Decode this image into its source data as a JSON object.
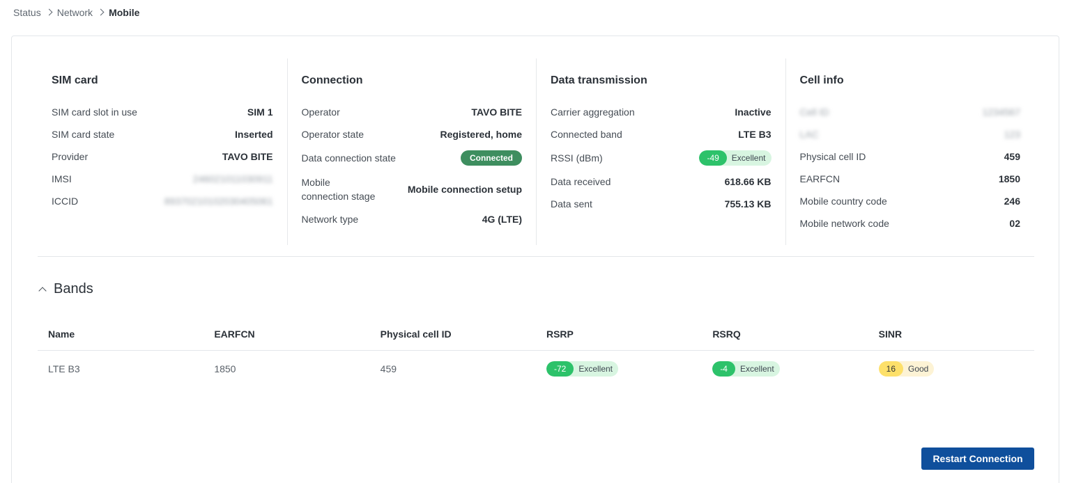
{
  "breadcrumb": [
    "Status",
    "Network",
    "Mobile"
  ],
  "sections": {
    "sim": {
      "title": "SIM card",
      "rows": [
        {
          "label": "SIM card slot in use",
          "value": "SIM 1"
        },
        {
          "label": "SIM card state",
          "value": "Inserted"
        },
        {
          "label": "Provider",
          "value": "TAVO BITE"
        },
        {
          "label": "IMSI",
          "value": "246021011030911"
        },
        {
          "label": "ICCID",
          "value": "89370210102030405061"
        }
      ]
    },
    "connection": {
      "title": "Connection",
      "rows": [
        {
          "label": "Operator",
          "value": "TAVO BITE"
        },
        {
          "label": "Operator state",
          "value": "Registered, home"
        },
        {
          "label": "Data connection state",
          "value": "Connected"
        },
        {
          "label": "Mobile connection stage",
          "value": "Mobile connection setup"
        },
        {
          "label": "Network type",
          "value": "4G (LTE)"
        }
      ]
    },
    "data": {
      "title": "Data transmission",
      "rows": [
        {
          "label": "Carrier aggregation",
          "value": "Inactive"
        },
        {
          "label": "Connected band",
          "value": "LTE B3"
        },
        {
          "label": "RSSI (dBm)",
          "value": "-49",
          "quality": "Excellent"
        },
        {
          "label": "Data received",
          "value": "618.66 KB"
        },
        {
          "label": "Data sent",
          "value": "755.13 KB"
        }
      ]
    },
    "cell": {
      "title": "Cell info",
      "rows": [
        {
          "label": "Cell ID",
          "value": "1234567"
        },
        {
          "label": "LAC",
          "value": "123"
        },
        {
          "label": "Physical cell ID",
          "value": "459"
        },
        {
          "label": "EARFCN",
          "value": "1850"
        },
        {
          "label": "Mobile country code",
          "value": "246"
        },
        {
          "label": "Mobile network code",
          "value": "02"
        }
      ]
    }
  },
  "bands": {
    "title": "Bands",
    "columns": [
      "Name",
      "EARFCN",
      "Physical cell ID",
      "RSRP",
      "RSRQ",
      "SINR"
    ],
    "rows": [
      {
        "name": "LTE B3",
        "earfcn": "1850",
        "pci": "459",
        "rsrp": "-72",
        "rsrp_q": "Excellent",
        "rsrq": "-4",
        "rsrq_q": "Excellent",
        "sinr": "16",
        "sinr_q": "Good"
      }
    ]
  },
  "actions": {
    "restart": "Restart Connection"
  },
  "colors": {
    "excellent": "#2dc26a",
    "good": "#fde06a",
    "connected": "#3e8e5f",
    "primary": "#0f4f9c"
  }
}
